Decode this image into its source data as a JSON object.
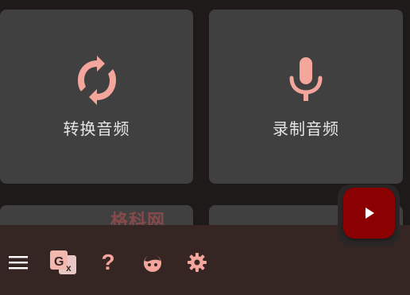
{
  "cards": {
    "convert": {
      "label": "转换音频",
      "icon": "convert-icon"
    },
    "record": {
      "label": "录制音频",
      "icon": "microphone-icon"
    }
  },
  "watermark": {
    "text": "格科网"
  },
  "bottom_bar": {
    "icons": [
      "menu-icon",
      "translate-icon",
      "help-icon",
      "face-icon",
      "settings-icon"
    ],
    "help_glyph": "?"
  },
  "fab": {
    "icon": "play-icon"
  },
  "colors": {
    "background": "#1f1a1a",
    "card": "#404040",
    "accent": "#f4a69c",
    "fab": "#8b0000",
    "bottom_bar": "#352624"
  }
}
